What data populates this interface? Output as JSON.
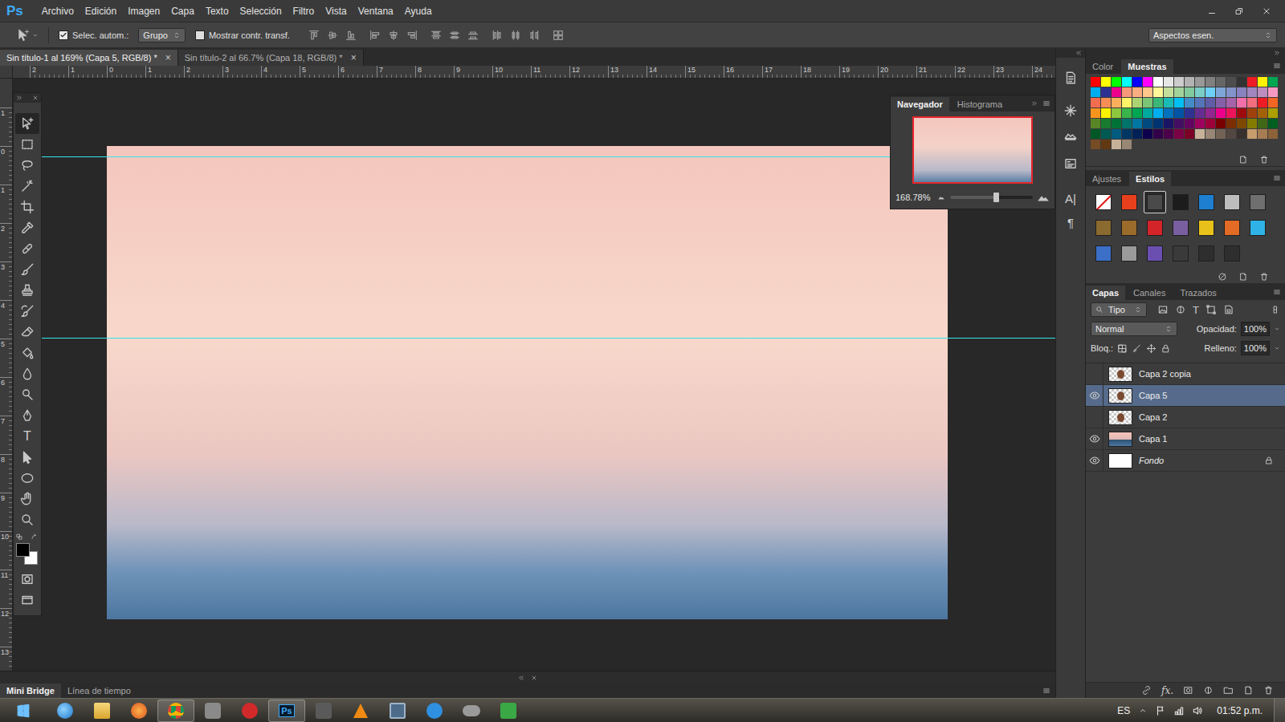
{
  "app": {
    "logo": "Ps"
  },
  "menu": [
    "Archivo",
    "Edición",
    "Imagen",
    "Capa",
    "Texto",
    "Selección",
    "Filtro",
    "Vista",
    "Ventana",
    "Ayuda"
  ],
  "options_bar": {
    "auto_select": {
      "label": "Selec. autom.:",
      "checked": true
    },
    "auto_select_target": "Grupo",
    "show_transform": {
      "label": "Mostrar contr. transf.",
      "checked": false
    },
    "workspace": "Aspectos esen."
  },
  "document_tabs": [
    {
      "label": "Sin título-1 al 169% (Capa 5, RGB/8) *",
      "close": "×",
      "selected": true
    },
    {
      "label": "Sin título-2 al 66.7% (Capa 18, RGB/8) *",
      "close": "×",
      "selected": false
    }
  ],
  "rulers": {
    "horizontal": [
      "2",
      "1",
      "0",
      "1",
      "2",
      "3",
      "4",
      "5",
      "6",
      "7",
      "8",
      "9",
      "10",
      "11",
      "12",
      "13",
      "14",
      "15",
      "16",
      "17",
      "18",
      "19",
      "20",
      "21",
      "22",
      "23",
      "24"
    ],
    "vertical": [
      "1",
      "0",
      "1",
      "2",
      "3",
      "4",
      "5",
      "6",
      "7",
      "8",
      "9",
      "10",
      "11",
      "12",
      "13"
    ]
  },
  "toolbox": {
    "tools": [
      {
        "selected": true
      },
      {
        "selected": false
      },
      {
        "selected": false
      },
      {
        "selected": false
      },
      {
        "selected": false
      },
      {
        "selected": false
      },
      {
        "selected": false
      },
      {
        "selected": false
      },
      {
        "selected": false
      },
      {
        "selected": false
      },
      {
        "selected": false
      },
      {
        "selected": false
      },
      {
        "selected": false
      },
      {
        "selected": false
      },
      {
        "selected": false
      },
      {
        "selected": false,
        "glyph": "T"
      },
      {
        "selected": false
      },
      {
        "selected": false
      },
      {
        "selected": false
      },
      {
        "selected": false
      }
    ],
    "foreground_color": "#000000",
    "background_color": "#ffffff"
  },
  "navigator": {
    "tabs": [
      {
        "label": "Navegador",
        "selected": true
      },
      {
        "label": "Histograma",
        "selected": false
      }
    ],
    "zoom": "168.78%",
    "zoom_slider": {
      "level": 0.55
    }
  },
  "dock": [
    {
      "kind": "icon"
    },
    {
      "kind": "icon"
    },
    {
      "kind": "icon"
    },
    {
      "kind": "icon"
    },
    {
      "kind": "glyph",
      "glyph": "A|"
    },
    {
      "kind": "glyph",
      "glyph": "¶"
    }
  ],
  "swatches_panel": {
    "tabs": [
      {
        "label": "Color",
        "selected": false
      },
      {
        "label": "Muestras",
        "selected": true
      }
    ],
    "swatches": [
      "#ff0000",
      "#ffff00",
      "#00ff00",
      "#00ffff",
      "#0000ff",
      "#ff00ff",
      "#ffffff",
      "#e6e6e6",
      "#cccccc",
      "#b3b3b3",
      "#999999",
      "#808080",
      "#666666",
      "#4d4d4d",
      "#333333",
      "#ed1c24",
      "#fff200",
      "#00a651",
      "#00aeef",
      "#2e3192",
      "#ec008c",
      "#f7977a",
      "#f9ad81",
      "#fdc68a",
      "#fff79a",
      "#c4df9b",
      "#a3d39c",
      "#82ca9d",
      "#7bcdc8",
      "#6ecff6",
      "#7ea7d8",
      "#8493ca",
      "#8882be",
      "#a187be",
      "#bc8dbf",
      "#f49ac2",
      "#f26c4f",
      "#f68e55",
      "#fbaf5c",
      "#fff467",
      "#acd372",
      "#7cc576",
      "#3bb878",
      "#1abbb4",
      "#00bff3",
      "#438cca",
      "#5574b9",
      "#605ca8",
      "#855fa8",
      "#a763a8",
      "#f06ea9",
      "#f26d7d",
      "#ed1c24",
      "#f26522",
      "#f7941d",
      "#fff200",
      "#8dc63f",
      "#39b54a",
      "#00a651",
      "#00a99d",
      "#00aeef",
      "#0072bc",
      "#0054a6",
      "#2e3192",
      "#662d91",
      "#92278f",
      "#ec008c",
      "#ed145b",
      "#9e0b0f",
      "#a0410d",
      "#a3620a",
      "#aba000",
      "#598527",
      "#197b30",
      "#007236",
      "#00746b",
      "#0076a3",
      "#004a80",
      "#003471",
      "#1b1464",
      "#440e62",
      "#630460",
      "#9e005d",
      "#9e0039",
      "#790000",
      "#7b2e00",
      "#7d4900",
      "#827b00",
      "#406618",
      "#005e20",
      "#005826",
      "#005952",
      "#005b7f",
      "#003663",
      "#002157",
      "#0d004c",
      "#32004b",
      "#4b0049",
      "#7b0046",
      "#7a0026",
      "#c7b299",
      "#998675",
      "#736357",
      "#534741",
      "#37302d",
      "#c69c6d",
      "#a67c52",
      "#8c6239",
      "#754c24",
      "#603913",
      "#c7b299",
      "#998675"
    ]
  },
  "styles_panel": {
    "tabs": [
      {
        "label": "Ajustes",
        "selected": false
      },
      {
        "label": "Estilos",
        "selected": true
      }
    ],
    "styles": [
      {
        "kind": "none",
        "color": "#ffffff",
        "selected": false
      },
      {
        "kind": "style",
        "color": "#e8401c",
        "selected": false
      },
      {
        "kind": "style",
        "color": "#4a4a4a",
        "selected": true
      },
      {
        "kind": "style",
        "color": "#1c1c1c",
        "selected": false
      },
      {
        "kind": "style",
        "color": "#1e7fd0",
        "selected": false
      },
      {
        "kind": "style",
        "color": "#bdbdbd",
        "selected": false
      },
      {
        "kind": "style",
        "color": "#6f6f6f",
        "selected": false
      },
      {
        "kind": "style",
        "color": "#8a6a2e",
        "selected": false
      },
      {
        "kind": "style",
        "color": "#9a6b2a",
        "selected": false
      },
      {
        "kind": "style",
        "color": "#d3242a",
        "selected": false
      },
      {
        "kind": "style",
        "color": "#7a5fa0",
        "selected": false
      },
      {
        "kind": "style",
        "color": "#e8c21a",
        "selected": false
      },
      {
        "kind": "style",
        "color": "#e46b25",
        "selected": false
      },
      {
        "kind": "style",
        "color": "#2fb3e6",
        "selected": false
      },
      {
        "kind": "style",
        "color": "#3b6fc8",
        "selected": false
      },
      {
        "kind": "style",
        "color": "#9a9a9a",
        "selected": false
      },
      {
        "kind": "style",
        "color": "#6a4fb0",
        "selected": false
      },
      {
        "kind": "style",
        "color": "#3a3a3a",
        "selected": false
      },
      {
        "kind": "style",
        "color": "#2e2e2e",
        "selected": false
      },
      {
        "kind": "style",
        "color": "#2e2e2e",
        "selected": false
      }
    ]
  },
  "layers_panel": {
    "tabs": [
      {
        "label": "Capas",
        "selected": true
      },
      {
        "label": "Canales",
        "selected": false
      },
      {
        "label": "Trazados",
        "selected": false
      }
    ],
    "filter": "Tipo",
    "filter_glyph": "T",
    "blend_mode": "Normal",
    "opacity_label": "Opacidad:",
    "opacity": "100%",
    "lock_label": "Bloq.:",
    "fill_label": "Relleno:",
    "fill": "100%",
    "layers": [
      {
        "name": "Capa 2 copia",
        "visible": false,
        "selected": false,
        "locked": false,
        "kind": "cutout"
      },
      {
        "name": "Capa 5",
        "visible": true,
        "selected": true,
        "locked": false,
        "kind": "cutout"
      },
      {
        "name": "Capa 2",
        "visible": false,
        "selected": false,
        "locked": false,
        "kind": "cutout"
      },
      {
        "name": "Capa 1",
        "visible": true,
        "selected": false,
        "locked": false,
        "kind": "photo"
      },
      {
        "name": "Fondo",
        "visible": true,
        "selected": false,
        "locked": true,
        "kind": "white"
      }
    ],
    "footer_fx": "fx."
  },
  "bottom_panel": {
    "tabs": [
      {
        "label": "Mini Bridge",
        "selected": true
      },
      {
        "label": "Línea de tiempo",
        "selected": false
      }
    ]
  },
  "taskbar": {
    "apps": [
      {
        "kind": "ie",
        "active": false
      },
      {
        "kind": "explorer",
        "active": false
      },
      {
        "kind": "media-player",
        "active": false
      },
      {
        "kind": "chrome",
        "active": true
      },
      {
        "kind": "generic",
        "active": false
      },
      {
        "kind": "red-app",
        "active": false
      },
      {
        "kind": "photoshop",
        "label": "Ps",
        "active": true
      },
      {
        "kind": "dark-app",
        "active": false
      },
      {
        "kind": "vlc",
        "active": false
      },
      {
        "kind": "window-app",
        "active": false
      },
      {
        "kind": "blue-app",
        "active": false
      },
      {
        "kind": "gamepad",
        "active": false
      },
      {
        "kind": "green-app",
        "active": false
      }
    ],
    "language": "ES",
    "clock": "01:52 p.m."
  }
}
